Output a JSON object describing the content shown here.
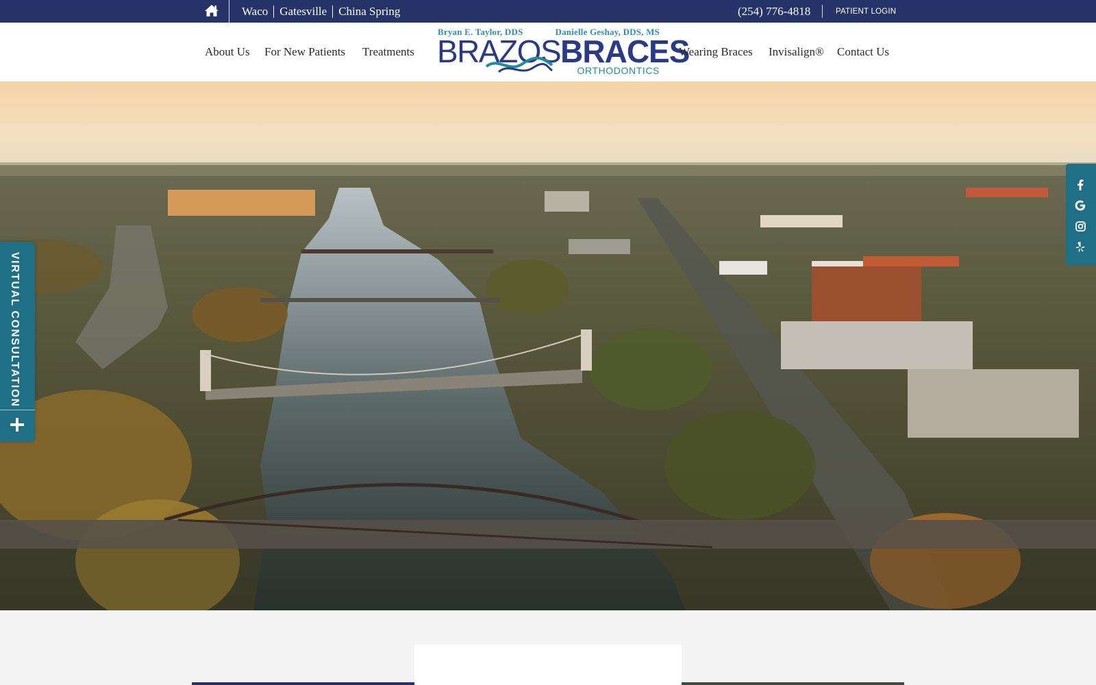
{
  "topbar": {
    "home_icon": "home-icon",
    "locations": [
      "Waco",
      "Gatesville",
      "China Spring"
    ],
    "phone": "(254) 776-4818",
    "patient_login": "PATIENT LOGIN"
  },
  "nav": {
    "left": [
      "About Us",
      "For New Patients",
      "Treatments"
    ],
    "right": [
      "Wearing Braces",
      "Invisalign®",
      "Contact Us"
    ]
  },
  "logo": {
    "doctor_1": "Bryan E. Taylor, DDS",
    "doctor_2": "Danielle Geshay, DDS, MS",
    "brazos": "BRAZOS",
    "braces": "BRACES",
    "orthodontics": "ORTHODONTICS"
  },
  "virtual_consultation": {
    "label": "VIRTUAL CONSULTATION",
    "icon": "plus-icon"
  },
  "social": [
    "facebook-icon",
    "google-icon",
    "instagram-icon",
    "yelp-icon"
  ],
  "colors": {
    "topbar": "#263369",
    "accent_teal": "#1f6f87",
    "logo_navy": "#2b3a86",
    "logo_blue": "#2e8fb0"
  }
}
